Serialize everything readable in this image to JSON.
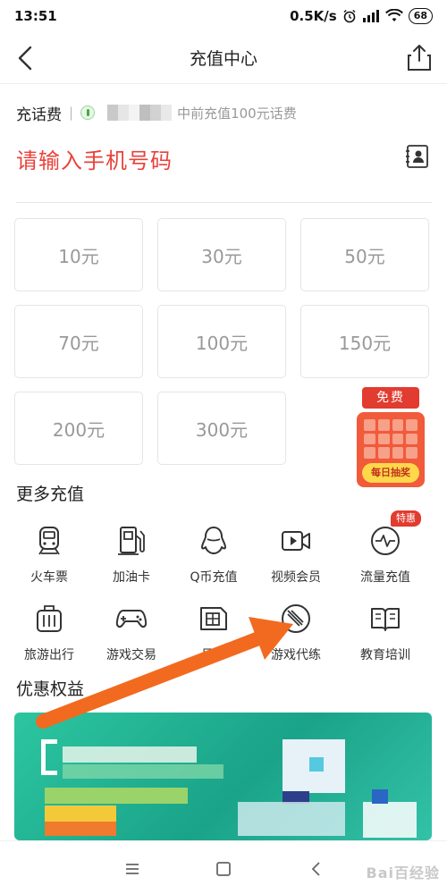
{
  "status": {
    "time": "13:51",
    "network_speed": "0.5K/s",
    "battery": "68"
  },
  "header": {
    "title": "充值中心"
  },
  "phone_recharge": {
    "label": "充话费",
    "separator": "|",
    "recent_text": "中前充值100元话费",
    "phone_placeholder": "请输入手机号码"
  },
  "amounts": [
    "10元",
    "30元",
    "50元",
    "70元",
    "100元",
    "150元",
    "200元",
    "300元"
  ],
  "lottery": {
    "tag": "免费",
    "button": "每日抽奖"
  },
  "more_recharge": {
    "title": "更多充值",
    "items": [
      {
        "label": "火车票",
        "icon": "train-icon"
      },
      {
        "label": "加油卡",
        "icon": "fuel-pump-icon"
      },
      {
        "label": "Q币充值",
        "icon": "penguin-icon"
      },
      {
        "label": "视频会员",
        "icon": "video-camera-icon"
      },
      {
        "label": "流量充值",
        "icon": "data-wave-icon",
        "badge": "特惠"
      },
      {
        "label": "旅游出行",
        "icon": "suitcase-icon"
      },
      {
        "label": "游戏交易",
        "icon": "gamepad-icon"
      },
      {
        "label": "号卡",
        "icon": "sim-card-icon"
      },
      {
        "label": "游戏代练",
        "icon": "sword-shield-icon"
      },
      {
        "label": "教育培训",
        "icon": "book-icon"
      }
    ]
  },
  "benefits": {
    "title": "优惠权益"
  },
  "watermark": "Bai百经验",
  "colors": {
    "accent_red": "#e8423a",
    "badge_red": "#e23b2f",
    "banner_green": "#1aa389",
    "annotation_orange": "#f26a1f"
  }
}
